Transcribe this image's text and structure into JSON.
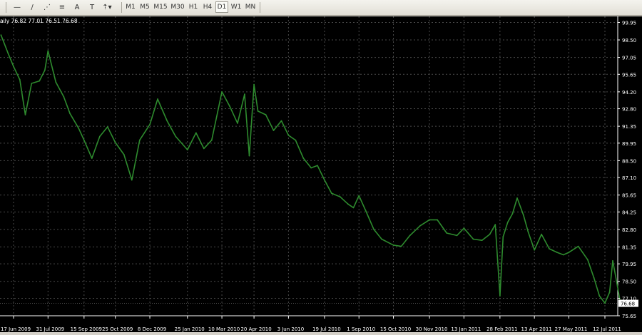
{
  "toolbar": {
    "tools": [
      {
        "name": "horizontal-line-icon",
        "glyph": "—"
      },
      {
        "name": "trendline-icon",
        "glyph": "/"
      },
      {
        "name": "fibonacci-icon",
        "glyph": "⋰"
      },
      {
        "name": "fibonacci-retracement-icon",
        "glyph": "≡"
      },
      {
        "name": "text-tool-icon",
        "glyph": "A"
      },
      {
        "name": "text-label-icon",
        "glyph": "T"
      },
      {
        "name": "arrows-icon",
        "glyph": "⇡▾"
      }
    ],
    "periods": [
      "M1",
      "M5",
      "M15",
      "M30",
      "H1",
      "H4",
      "D1",
      "W1",
      "MN"
    ],
    "active_period": "D1"
  },
  "chart_data": {
    "type": "line",
    "title": "aily  76.82 77.01 76.51 76.68",
    "current_price": "76.68",
    "line_color": "#2e8b2e",
    "background": "#000000",
    "grid": true,
    "ylim": [
      75.65,
      100.45
    ],
    "y_ticks": [
      "99.95",
      "98.50",
      "97.05",
      "95.65",
      "94.20",
      "92.80",
      "91.35",
      "89.95",
      "88.50",
      "87.10",
      "85.65",
      "84.25",
      "82.80",
      "81.35",
      "79.95",
      "78.50",
      "77.10",
      "75.65"
    ],
    "x_ticks": [
      "17 Jun 2009",
      "31 Jul 2009",
      "15 Sep 2009",
      "25 Oct 2009",
      "8 Dec 2009",
      "25 Jan 2010",
      "10 Mar 2010",
      "20 Apr 2010",
      "3 Jun 2010",
      "19 Jul 2010",
      "1 Sep 2010",
      "15 Oct 2010",
      "30 Nov 2010",
      "13 Jan 2011",
      "28 Feb 2011",
      "13 Apr 2011",
      "27 May 2011",
      "12 Jul 2011"
    ],
    "x": [
      "2009-06-01",
      "2009-06-10",
      "2009-06-17",
      "2009-06-25",
      "2009-07-02",
      "2009-07-10",
      "2009-07-20",
      "2009-07-27",
      "2009-07-31",
      "2009-08-10",
      "2009-08-20",
      "2009-08-28",
      "2009-09-08",
      "2009-09-15",
      "2009-09-25",
      "2009-10-05",
      "2009-10-15",
      "2009-10-25",
      "2009-11-05",
      "2009-11-15",
      "2009-11-25",
      "2009-12-08",
      "2009-12-18",
      "2009-12-30",
      "2010-01-10",
      "2010-01-25",
      "2010-02-05",
      "2010-02-15",
      "2010-02-25",
      "2010-03-10",
      "2010-03-20",
      "2010-03-30",
      "2010-04-08",
      "2010-04-14",
      "2010-04-20",
      "2010-04-25",
      "2010-05-05",
      "2010-05-15",
      "2010-05-25",
      "2010-06-03",
      "2010-06-12",
      "2010-06-22",
      "2010-07-02",
      "2010-07-10",
      "2010-07-19",
      "2010-07-28",
      "2010-08-08",
      "2010-08-18",
      "2010-08-25",
      "2010-09-01",
      "2010-09-10",
      "2010-09-20",
      "2010-09-30",
      "2010-10-15",
      "2010-10-25",
      "2010-11-05",
      "2010-11-18",
      "2010-11-30",
      "2010-12-10",
      "2010-12-22",
      "2011-01-04",
      "2011-01-13",
      "2011-01-25",
      "2011-02-05",
      "2011-02-15",
      "2011-02-22",
      "2011-02-28",
      "2011-03-04",
      "2011-03-10",
      "2011-03-16",
      "2011-03-22",
      "2011-03-30",
      "2011-04-05",
      "2011-04-13",
      "2011-04-22",
      "2011-05-02",
      "2011-05-12",
      "2011-05-20",
      "2011-05-27",
      "2011-06-08",
      "2011-06-20",
      "2011-06-28",
      "2011-07-05",
      "2011-07-12",
      "2011-07-18",
      "2011-07-22",
      "2011-07-28",
      "2011-08-01",
      "2011-08-04"
    ],
    "values": [
      98.9,
      97.4,
      96.3,
      95.2,
      92.3,
      94.9,
      95.1,
      96.0,
      97.6,
      95.0,
      93.8,
      92.4,
      91.2,
      90.2,
      88.7,
      90.5,
      91.3,
      90.0,
      89.0,
      86.9,
      90.2,
      91.5,
      93.6,
      91.8,
      90.5,
      89.4,
      90.8,
      89.5,
      90.2,
      94.2,
      93.0,
      91.6,
      94.0,
      88.9,
      94.8,
      92.6,
      92.3,
      91.0,
      91.8,
      90.6,
      90.2,
      88.7,
      87.9,
      88.1,
      86.9,
      85.8,
      85.5,
      84.9,
      84.6,
      85.6,
      84.3,
      82.8,
      82.0,
      81.5,
      81.4,
      82.3,
      83.1,
      83.6,
      83.6,
      82.5,
      82.3,
      82.9,
      82.0,
      81.9,
      82.4,
      83.2,
      77.3,
      82.2,
      83.4,
      84.1,
      85.4,
      84.0,
      82.6,
      81.1,
      82.4,
      81.2,
      80.9,
      80.7,
      80.9,
      81.4,
      80.3,
      78.8,
      77.3,
      76.7,
      77.6,
      80.2,
      78.1,
      76.6,
      76.7
    ]
  }
}
